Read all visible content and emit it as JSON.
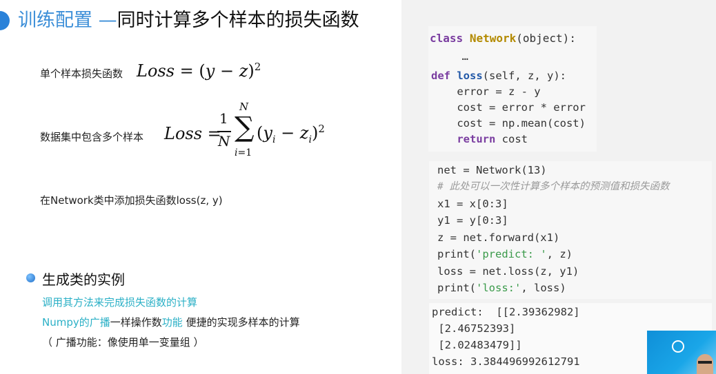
{
  "title": {
    "part1": "训练配置",
    "dash": " —",
    "part2": "同时计算多个样本的损失函数"
  },
  "left": {
    "single_label": "单个样本损失函数",
    "dataset_label": "数据集中包含多个样本",
    "add_label": "在Network类中添加损失函数loss(z, y)",
    "bullet": "生成类的实例",
    "sub1": "调用其方法来完成损失函数的计算",
    "sub2_a": "Numpy的",
    "sub2_b": "广播",
    "sub2_c": "一样操作数",
    "sub2_d": "功能",
    "sub2_e": " 便捷的实现多样本的计算",
    "sub3": "（ 广播功能：像使用单一变量组 ）"
  },
  "code": {
    "b1": [
      "class Network(object):",
      "  …",
      "def loss(self, z, y):",
      "    error = z - y",
      "    cost = error * error",
      "    cost = np.mean(cost)",
      "    return cost"
    ],
    "b2": [
      "net = Network(13)",
      "# 此处可以一次性计算多个样本的预测值和损失函数",
      "x1 = x[0:3]",
      "y1 = y[0:3]",
      "z = net.forward(x1)",
      "print('predict: ', z)",
      "loss = net.loss(z, y1)",
      "print('loss:', loss)"
    ],
    "out": [
      "predict:  [[2.39362982]",
      " [2.46752393]",
      " [2.02483479]]",
      "loss: 3.384496992612791"
    ]
  }
}
